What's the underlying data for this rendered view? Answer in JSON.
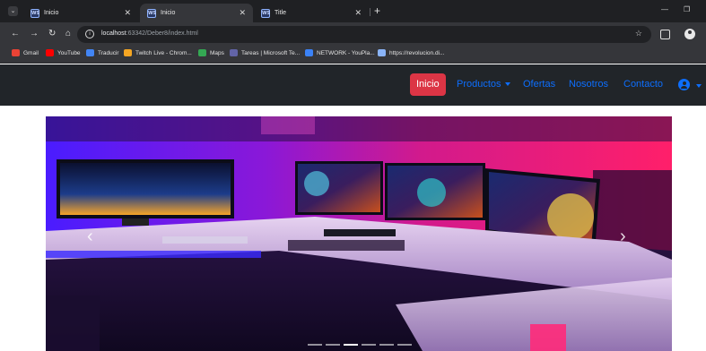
{
  "browser": {
    "tabs": [
      {
        "label": "Inicio",
        "favicon": "webstorm-icon"
      },
      {
        "label": "Inicio",
        "favicon": "webstorm-icon"
      },
      {
        "label": "Title",
        "favicon": "webstorm-icon"
      }
    ],
    "url_host": "localhost",
    "url_path": ":63342/Deber8/index.html",
    "bookmarks": [
      {
        "label": "Gmail",
        "icon": "gmail-icon",
        "color": "#ea4335"
      },
      {
        "label": "YouTube",
        "icon": "youtube-icon",
        "color": "#ff0000"
      },
      {
        "label": "Traducir",
        "icon": "translate-icon",
        "color": "#4285f4"
      },
      {
        "label": "Twitch Live - Chrom...",
        "icon": "twitch-icon",
        "color": "#f5a623"
      },
      {
        "label": "Maps",
        "icon": "maps-icon",
        "color": "#34a853"
      },
      {
        "label": "Tareas | Microsoft Te...",
        "icon": "teams-icon",
        "color": "#6264a7"
      },
      {
        "label": "NETWORK - YouPla...",
        "icon": "network-icon",
        "color": "#3b82f6"
      },
      {
        "label": "https://revolucion.di...",
        "icon": "link-icon",
        "color": "#8ab4f8"
      }
    ]
  },
  "navbar": {
    "links": [
      {
        "label": "Inicio",
        "active": true
      },
      {
        "label": "Productos",
        "dropdown": true
      },
      {
        "label": "Ofertas"
      },
      {
        "label": "Nosotros"
      },
      {
        "label": "Contacto"
      }
    ],
    "colors": {
      "bg": "#212529",
      "link": "#0d6efd",
      "active_bg": "#dc3545"
    }
  },
  "carousel": {
    "image_desc": "gaming-desk-setup",
    "slides": 6,
    "active_slide": 3,
    "prev_icon": "chevron-left-icon",
    "next_icon": "chevron-right-icon"
  }
}
